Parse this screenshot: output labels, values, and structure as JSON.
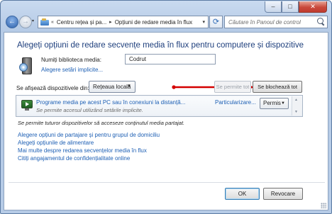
{
  "window": {
    "caption_buttons": {
      "minimize": "–",
      "maximize": "□",
      "close": "✕"
    }
  },
  "nav": {
    "back_icon": "←",
    "forward_icon": "→",
    "dropdown_icon": "▾",
    "breadcrumbs": [
      "«",
      "Centru rețea și pa...",
      "▸",
      "Opțiuni de redare media în flux",
      "▾"
    ],
    "refresh_icon": "⟳",
    "search_placeholder": "Căutare în Panoul de control"
  },
  "content": {
    "title": "Alegeți opțiuni de redare secvențe media în flux pentru computere și dispozitive",
    "library_label": "Numiți biblioteca media:",
    "library_value": "Codrut",
    "default_settings_link": "Alegere setări implicite...",
    "show_devices_label": "Se afișează dispozitivele din:",
    "network_select": "Rețeaua locală",
    "allow_all_label": "Se permite tot",
    "block_all_label": "Se blochează tot",
    "device": {
      "name": "Programe media pe acest PC sau în conexiuni la distanță...",
      "description": "Se permite accesul utilizând setările implicite.",
      "customize_link": "Particularizare...",
      "permission": "Permis"
    },
    "access_note": "Se permite tuturor dispozitivelor să acceseze conținutul media partajat.",
    "links": {
      "sharing": "Alegere opțiuni de partajare și pentru grupul de domiciliu",
      "power": "Alegeți opțiunile de alimentare",
      "more": "Mai multe despre redarea secvențelor media în flux",
      "privacy": "Citiți angajamentul de confidențialitate online"
    },
    "ok_label": "OK",
    "cancel_label": "Revocare"
  },
  "colors": {
    "link": "#1d5fb4",
    "title": "#1d3e7c",
    "annotation_arrow": "#d40000"
  }
}
